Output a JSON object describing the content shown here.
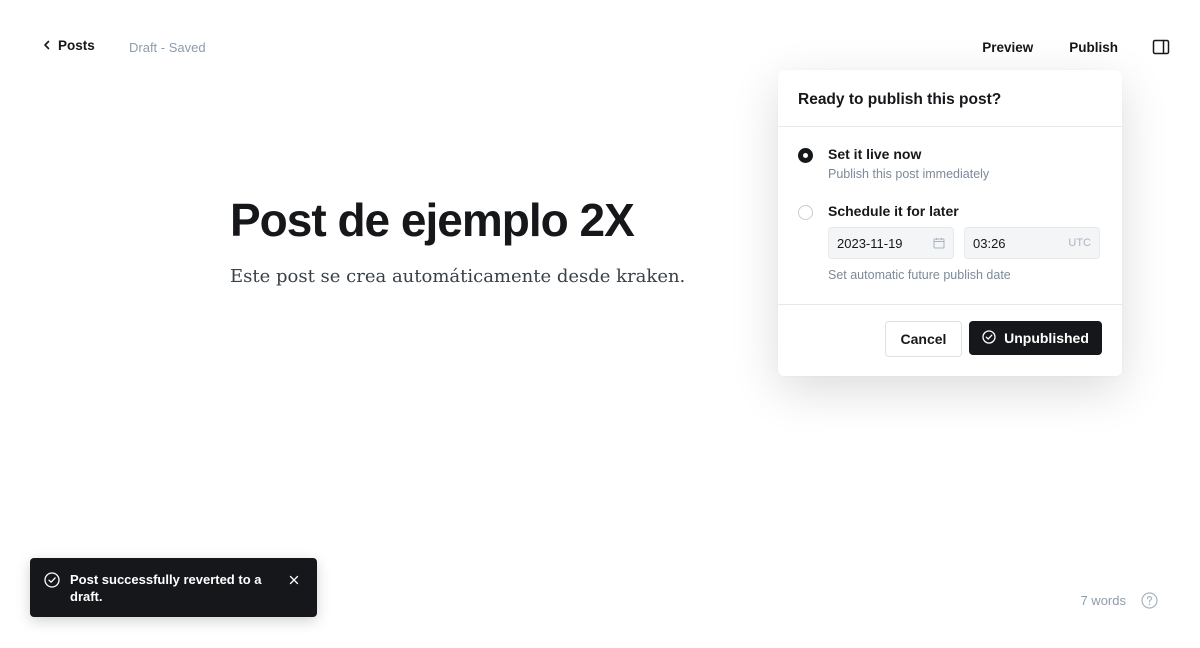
{
  "topbar": {
    "back_label": "Posts",
    "status": "Draft - Saved",
    "preview_label": "Preview",
    "publish_label": "Publish"
  },
  "post": {
    "title": "Post de ejemplo 2X",
    "excerpt": "Este post se crea automáticamente desde kraken."
  },
  "publish_panel": {
    "heading": "Ready to publish this post?",
    "live": {
      "title": "Set it live now",
      "description": "Publish this post immediately",
      "selected": true
    },
    "later": {
      "title": "Schedule it for later",
      "date": "2023-11-19",
      "time": "03:26",
      "timezone": "UTC",
      "hint": "Set automatic future publish date",
      "selected": false
    },
    "cancel_label": "Cancel",
    "confirm_label": "Unpublished"
  },
  "toast": {
    "message": "Post successfully reverted to a draft."
  },
  "footer": {
    "word_count": "7 words"
  }
}
